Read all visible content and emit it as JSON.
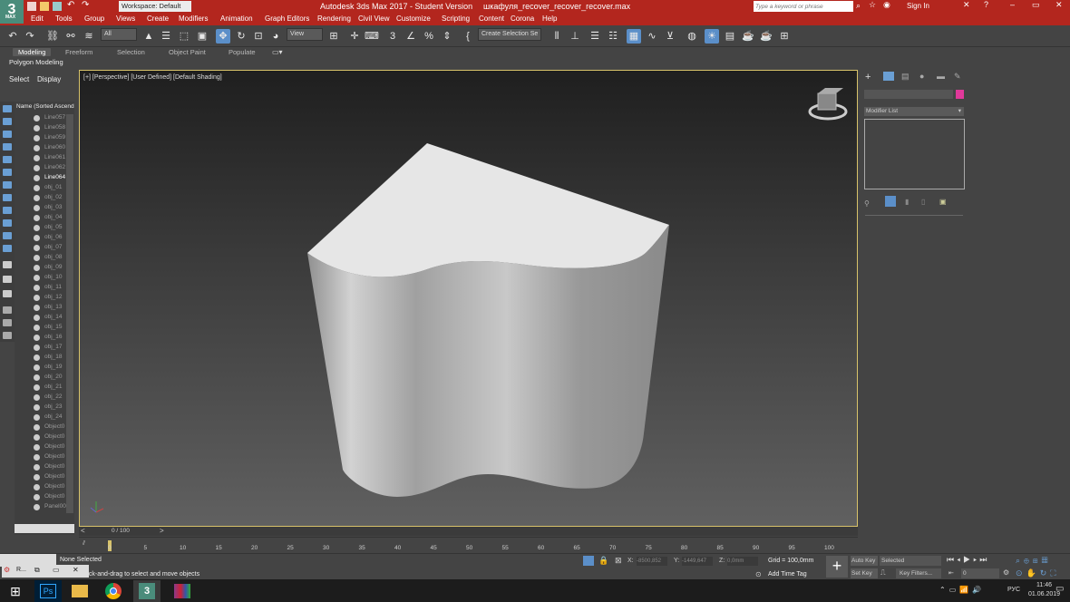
{
  "app": {
    "logo": "3",
    "logo_sub": "MAX",
    "title": "Autodesk 3ds Max 2017 - Student Version",
    "file": "шкафуля_recover_recover_recover.max",
    "workspace": "Workspace: Default",
    "search_placeholder": "Type a keyword or phrase",
    "sign_in": "Sign In"
  },
  "menu": [
    "Edit",
    "Tools",
    "Group",
    "Views",
    "Create",
    "Modifiers",
    "Animation",
    "Graph Editors",
    "Rendering",
    "Civil View",
    "Customize",
    "Scripting",
    "Content",
    "Corona",
    "Help"
  ],
  "toolbar": {
    "selection_filter": "All",
    "ref_coord": "View",
    "named_selection": "Create Selection Se"
  },
  "ribbon": {
    "tabs": [
      "Modeling",
      "Freeform",
      "Selection",
      "Object Paint",
      "Populate"
    ],
    "subtitle": "Polygon Modeling"
  },
  "scene_explorer": {
    "tabs": [
      "Select",
      "Display"
    ],
    "column_header": "Name (Sorted Ascend",
    "rows": [
      "Line057",
      "Line058",
      "Line059",
      "Line060",
      "Line061",
      "Line062",
      "Line064",
      "obj_01",
      "obj_02",
      "obj_03",
      "obj_04",
      "obj_05",
      "obj_06",
      "obj_07",
      "obj_08",
      "obj_09",
      "obj_10",
      "obj_11",
      "obj_12",
      "obj_13",
      "obj_14",
      "obj_15",
      "obj_16",
      "obj_17",
      "obj_18",
      "obj_19",
      "obj_20",
      "obj_21",
      "obj_22",
      "obj_23",
      "obj_24",
      "Object0",
      "Object0",
      "Object0",
      "Object0",
      "Object0",
      "Object0",
      "Object0",
      "Object0",
      "Panel00"
    ]
  },
  "viewport": {
    "label": "[+] [Perspective] [User Defined] [Default Shading]"
  },
  "command_panel": {
    "modifier_list": "Modifier List"
  },
  "timeline": {
    "frame": "0 / 100",
    "ticks": [
      "0",
      "5",
      "10",
      "15",
      "20",
      "25",
      "30",
      "35",
      "40",
      "45",
      "50",
      "55",
      "60",
      "65",
      "70",
      "75",
      "80",
      "85",
      "90",
      "95",
      "100"
    ]
  },
  "status": {
    "none_selected": "None Selected",
    "prompt": "Click or click-and-drag to select and move objects",
    "x_label": "X:",
    "x_value": "-8500,852",
    "y_label": "Y:",
    "y_value": "-1449,647",
    "z_label": "Z:",
    "z_value": "0,0mm",
    "grid": "Grid = 100,0mm",
    "add_time_tag": "Add Time Tag",
    "auto_key": "Auto Key",
    "set_key": "Set Key",
    "selected": "Selected",
    "key_filters": "Key Filters...",
    "frame_field": "0",
    "mini_tab": "R..."
  },
  "taskbar": {
    "lang": "РУС",
    "time": "11:46",
    "date": "01.06.2019"
  },
  "colors": {
    "titlebar": "#b3261e",
    "viewport_border": "#d8c36a",
    "color_swatch": "#e0399a"
  }
}
